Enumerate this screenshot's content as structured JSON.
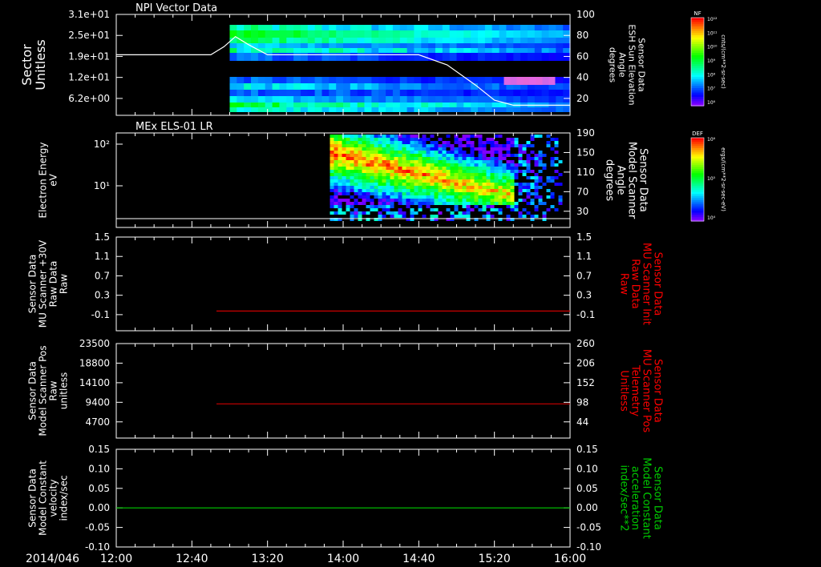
{
  "date_label": "2014/046",
  "time_ticks": [
    "12:00",
    "12:40",
    "13:20",
    "14:00",
    "14:40",
    "15:20",
    "16:00"
  ],
  "time_range": [
    0,
    240
  ],
  "chart_data": [
    {
      "id": "panel1",
      "type": "heatmap",
      "title": "NPI Vector Data",
      "ylabel": [
        "Sector",
        "Unitless"
      ],
      "yticks": [
        "3.1e+01",
        "2.5e+01",
        "1.9e+01",
        "1.2e+01",
        "6.2e+00"
      ],
      "ylabel_right": [
        "Sensor Data",
        "ESH Sun Elevation",
        "Angle",
        "degrees"
      ],
      "yticks_right": [
        "100",
        "80",
        "60",
        "40",
        "20"
      ],
      "ylim_right": [
        0,
        100
      ],
      "colorbar_title": "NF",
      "colorbar_ticks": [
        "10¹²",
        "10¹¹",
        "10¹⁰",
        "10⁹",
        "10⁸",
        "10⁷",
        "10⁶"
      ],
      "colorbar_unit": "cnts/(cm**2-sr-sec)",
      "data_start_minutes": 60,
      "line_series": {
        "name": "ESH Sun Elevation Angle",
        "color": "#ffffff",
        "x_minutes": [
          0,
          50,
          57,
          63,
          70,
          80,
          160,
          175,
          190,
          200,
          210,
          240
        ],
        "y": [
          60,
          60,
          68,
          78,
          70,
          60,
          60,
          50,
          30,
          15,
          10,
          10
        ]
      }
    },
    {
      "id": "panel2",
      "type": "heatmap",
      "title": "MEx ELS-01 LR",
      "ylabel": [
        "Electron Energy",
        "eV"
      ],
      "yticks": [
        "10²",
        "10¹"
      ],
      "ylabel_right": [
        "Sensor Data",
        "Model Scanner",
        "Angle",
        "degrees"
      ],
      "yticks_right": [
        "190",
        "150",
        "110",
        "70",
        "30"
      ],
      "ylim_right": [
        0,
        190
      ],
      "colorbar_title": "DEF",
      "colorbar_ticks": [
        "10⁶",
        "10⁵",
        "10⁴"
      ],
      "colorbar_unit": "ergs/(cm**2-sr-sec-eV)",
      "data_start_minutes": 113,
      "data_end_minutes": 210,
      "line_series": {
        "name": "Model Scanner Angle",
        "color": "#ffffff",
        "x_minutes": [
          0,
          240
        ],
        "y": [
          0,
          0
        ]
      }
    },
    {
      "id": "panel3",
      "type": "line",
      "ylabel": [
        "Sensor Data",
        "MU Scanner +30V",
        "Raw Data",
        "Raw"
      ],
      "yticks": [
        "1.5",
        "1.1",
        "0.7",
        "0.3",
        "-0.1"
      ],
      "yticks_right": [
        "1.5",
        "1.1",
        "0.7",
        "0.3",
        "-0.1"
      ],
      "ylim": [
        -0.4,
        1.5
      ],
      "ylabel_right": [
        "Sensor Data",
        "MU Scanner Init",
        "Raw Data",
        "Raw"
      ],
      "ylabel_right_color": "#ff0000",
      "series": [
        {
          "name": "MU Scanner Init Raw Data",
          "color": "#cc0000",
          "x_minutes": [
            53,
            240
          ],
          "y": [
            0.0,
            0.0
          ]
        }
      ]
    },
    {
      "id": "panel4",
      "type": "line",
      "ylabel": [
        "Sensor Data",
        "Model Scanner Pos",
        "Raw",
        "unitless"
      ],
      "yticks": [
        "23500",
        "18800",
        "14100",
        "9400",
        "4700"
      ],
      "yticks_right": [
        "260",
        "206",
        "152",
        "98",
        "44"
      ],
      "ylim": [
        0,
        23500
      ],
      "ylabel_right": [
        "Sensor Data",
        "MU Scanner Pos",
        "Telemetry",
        "Unitless"
      ],
      "ylabel_right_color": "#ff0000",
      "series": [
        {
          "name": "MU Scanner Pos Telemetry",
          "color": "#cc0000",
          "x_minutes": [
            53,
            240
          ],
          "y": [
            8500,
            8500
          ]
        }
      ]
    },
    {
      "id": "panel5",
      "type": "line",
      "ylabel": [
        "Sensor Data",
        "Model Constant",
        "velocity",
        "index/sec"
      ],
      "yticks": [
        "0.15",
        "0.10",
        "0.05",
        "0.00",
        "-0.05",
        "-0.10"
      ],
      "yticks_right": [
        "0.15",
        "0.10",
        "0.05",
        "0.00",
        "-0.05",
        "-0.10"
      ],
      "ylim": [
        -0.1,
        0.15
      ],
      "ylabel_right": [
        "Sensor Data",
        "Model Constant",
        "acceleration",
        "index/sec**2"
      ],
      "ylabel_right_color": "#00cc00",
      "series": [
        {
          "name": "Model Constant acceleration",
          "color": "#00cc00",
          "x_minutes": [
            0,
            240
          ],
          "y": [
            0.0,
            0.0
          ]
        }
      ]
    }
  ]
}
